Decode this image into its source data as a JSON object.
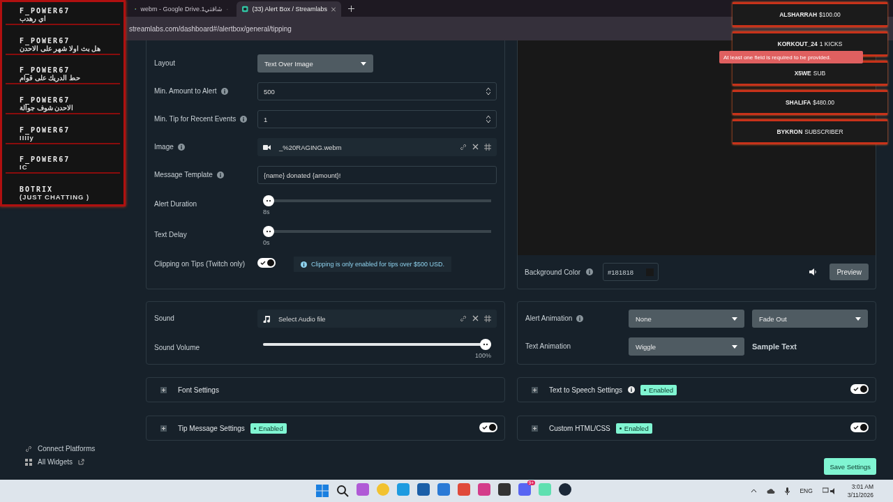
{
  "browser": {
    "tabs": [
      {
        "title": "webm - Google Drive.1شاقتي",
        "selected": false
      },
      {
        "title": "(33) Alert Box / Streamlabs",
        "selected": true
      }
    ],
    "url": "streamlabs.com/dashboard#/alertbox/general/tipping"
  },
  "sidebar": {
    "links": [
      {
        "label": "Connect Platforms",
        "external": false
      },
      {
        "label": "All Widgets",
        "external": true
      }
    ]
  },
  "settings": {
    "fields": [
      {
        "kind": "select",
        "label": "Layout",
        "info": false,
        "value": "Text Over Image"
      },
      {
        "kind": "number",
        "label": "Min. Amount to Alert",
        "info": true,
        "value": "500"
      },
      {
        "kind": "number",
        "label": "Min. Tip for Recent Events",
        "info": true,
        "value": "1"
      },
      {
        "kind": "file",
        "label": "Image",
        "info": true,
        "value": "_%20RAGING.webm"
      },
      {
        "kind": "text",
        "label": "Message Template",
        "info": true,
        "value": "{name} donated {amount}!"
      },
      {
        "kind": "slider",
        "label": "Alert Duration",
        "info": false,
        "level": 0,
        "reading": "8s"
      },
      {
        "kind": "slider",
        "label": "Text Delay",
        "info": false,
        "level": 0,
        "reading": "0s"
      },
      {
        "kind": "toggle",
        "label": "Clipping on Tips (Twitch only)",
        "info": false,
        "on": true,
        "note": "Clipping is only enabled for tips over $500 USD."
      }
    ]
  },
  "preview": {
    "label": "Background Color",
    "value": "#181818",
    "button": "Preview"
  },
  "sound": {
    "fields": [
      {
        "kind": "file",
        "label": "Sound",
        "info": false,
        "value": "Select Audio file"
      },
      {
        "kind": "slider",
        "label": "Sound Volume",
        "info": false,
        "level": 1,
        "reading": "100%"
      }
    ]
  },
  "animation": {
    "rows": [
      {
        "label": "Alert Animation",
        "info": true,
        "selects": [
          "None",
          "Fade Out"
        ]
      },
      {
        "label": "Text Animation",
        "info": false,
        "selects": [
          "Wiggle"
        ]
      }
    ],
    "sample": "Sample Text"
  },
  "sections": [
    {
      "title": "Font Settings",
      "info": false
    },
    {
      "title": "Text to Speech Settings",
      "info": true,
      "badge": "Enabled",
      "on": true
    },
    {
      "title": "Tip Message Settings",
      "info": false,
      "badge": "Enabled",
      "on": true
    },
    {
      "title": "Custom HTML/CSS",
      "info": false,
      "badge": "Enabled",
      "on": true
    }
  ],
  "save_button": "Save Settings",
  "toast": "At least one field is required to be provided.",
  "stream_overlay": {
    "events": [
      {
        "user": "F_POWER67",
        "message": "اي رهدب"
      },
      {
        "user": "F_POWER67",
        "message": "هل بث اولا شهر على الاحدن"
      },
      {
        "user": "F_POWER67",
        "message": "حط الدريك على قوام"
      },
      {
        "user": "F_POWER67",
        "message": "الاحدن شوف جوالة"
      },
      {
        "user": "F_POWER67",
        "message": "IIIIy"
      },
      {
        "user": "F_POWER67",
        "message": "IC"
      },
      {
        "user": "BOTRIX",
        "message": "(JUST CHATTING )"
      }
    ],
    "alerts": [
      {
        "name": "ALSHARRAH",
        "detail": "$100.00"
      },
      {
        "name": "KORKOUT_24",
        "detail": "1 KICKS"
      },
      {
        "name": "X5WE",
        "detail": "SUB"
      },
      {
        "name": "SHALIFA",
        "detail": "$480.00"
      },
      {
        "name": "BYKRON",
        "detail": "SUBSCRIBER"
      }
    ]
  },
  "taskbar": {
    "badge": "9+",
    "language": "ENG",
    "time": "3:01 AM",
    "date": "3/11/2026"
  }
}
